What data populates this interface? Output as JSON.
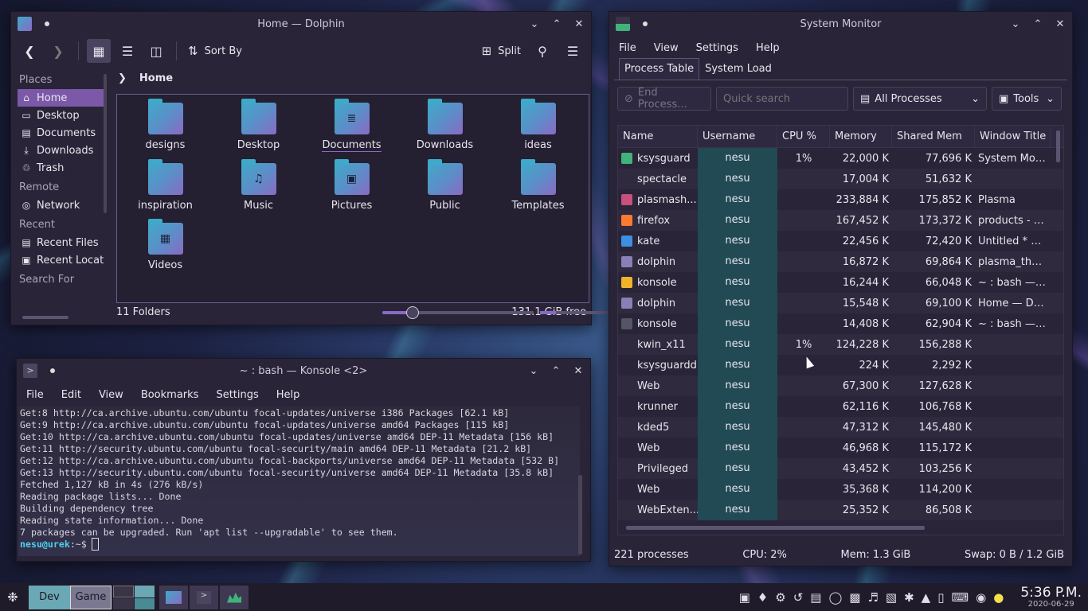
{
  "dolphin": {
    "title": "Home — Dolphin",
    "toolbar": {
      "sort_label": "Sort By",
      "split_label": "Split"
    },
    "places": {
      "sections": [
        {
          "header": "Places",
          "items": [
            "Home",
            "Desktop",
            "Documents",
            "Downloads",
            "Trash"
          ]
        },
        {
          "header": "Remote",
          "items": [
            "Network"
          ]
        },
        {
          "header": "Recent",
          "items": [
            "Recent Files",
            "Recent Locat"
          ]
        },
        {
          "header": "Search For",
          "items": []
        }
      ]
    },
    "breadcrumb": "Home",
    "folders": [
      "designs",
      "Desktop",
      "Documents",
      "Downloads",
      "ideas",
      "inspiration",
      "Music",
      "Pictures",
      "Public",
      "Templates",
      "Videos"
    ],
    "status": {
      "count": "11 Folders",
      "free": "131.1 GiB free"
    },
    "zoom_fraction": 0.2,
    "disk_used_fraction": 0.2
  },
  "konsole": {
    "title": "~ : bash — Konsole <2>",
    "menu": [
      "File",
      "Edit",
      "View",
      "Bookmarks",
      "Settings",
      "Help"
    ],
    "lines": [
      "Get:8 http://ca.archive.ubuntu.com/ubuntu focal-updates/universe i386 Packages [62.1 kB]",
      "Get:9 http://ca.archive.ubuntu.com/ubuntu focal-updates/universe amd64 Packages [115 kB]",
      "Get:10 http://ca.archive.ubuntu.com/ubuntu focal-updates/universe amd64 DEP-11 Metadata [156 kB]",
      "Get:11 http://security.ubuntu.com/ubuntu focal-security/main amd64 DEP-11 Metadata [21.2 kB]",
      "Get:12 http://ca.archive.ubuntu.com/ubuntu focal-backports/universe amd64 DEP-11 Metadata [532 B]",
      "Get:13 http://security.ubuntu.com/ubuntu focal-security/universe amd64 DEP-11 Metadata [35.8 kB]",
      "Fetched 1,127 kB in 4s (276 kB/s)",
      "Reading package lists... Done",
      "Building dependency tree",
      "Reading state information... Done",
      "7 packages can be upgraded. Run 'apt list --upgradable' to see them."
    ],
    "prompt": "nesu@urek",
    "prompt_suffix": ":~$ "
  },
  "sysmon": {
    "title": "System Monitor",
    "menu": [
      "File",
      "View",
      "Settings",
      "Help"
    ],
    "tabs": [
      "Process Table",
      "System Load"
    ],
    "end_process": "End Process...",
    "search_placeholder": "Quick search",
    "filter": "All Processes",
    "tools": "Tools",
    "columns": [
      "Name",
      "Username",
      "CPU %",
      "Memory",
      "Shared Mem",
      "Window Title"
    ],
    "rows": [
      {
        "name": "ksysguard",
        "user": "nesu",
        "cpu": "1%",
        "mem": "22,000 K",
        "shared": "77,696 K",
        "win": "System Monit..",
        "icon": "#3fb37a"
      },
      {
        "name": "spectacle",
        "user": "nesu",
        "cpu": "",
        "mem": "17,004 K",
        "shared": "51,632 K",
        "win": "",
        "icon": ""
      },
      {
        "name": "plasmash...",
        "user": "nesu",
        "cpu": "",
        "mem": "233,884 K",
        "shared": "175,852 K",
        "win": "Plasma",
        "icon": "#c94f7c"
      },
      {
        "name": "firefox",
        "user": "nesu",
        "cpu": "",
        "mem": "167,452 K",
        "shared": "173,372 K",
        "win": "products - pli...",
        "icon": "#ff7a2f"
      },
      {
        "name": "kate",
        "user": "nesu",
        "cpu": "",
        "mem": "22,456 K",
        "shared": "72,420 K",
        "win": "Untitled * — ...",
        "icon": "#3d8fe0"
      },
      {
        "name": "dolphin",
        "user": "nesu",
        "cpu": "",
        "mem": "16,872 K",
        "shared": "69,864 K",
        "win": "plasma_them...",
        "icon": "#8a80b8"
      },
      {
        "name": "konsole",
        "user": "nesu",
        "cpu": "",
        "mem": "16,244 K",
        "shared": "66,048 K",
        "win": "~ : bash — Ko...",
        "icon": "#f0b429"
      },
      {
        "name": "dolphin",
        "user": "nesu",
        "cpu": "",
        "mem": "15,548 K",
        "shared": "69,100 K",
        "win": "Home — Dol...",
        "icon": "#8a80b8"
      },
      {
        "name": "konsole",
        "user": "nesu",
        "cpu": "",
        "mem": "14,408 K",
        "shared": "62,904 K",
        "win": "~ : bash — Ko...",
        "icon": "#555566"
      },
      {
        "name": "kwin_x11",
        "user": "nesu",
        "cpu": "1%",
        "mem": "124,228 K",
        "shared": "156,288 K",
        "win": "",
        "icon": ""
      },
      {
        "name": "ksysguardd",
        "user": "nesu",
        "cpu": "",
        "mem": "224 K",
        "shared": "2,292 K",
        "win": "",
        "icon": ""
      },
      {
        "name": "Web",
        "user": "nesu",
        "cpu": "",
        "mem": "67,300 K",
        "shared": "127,628 K",
        "win": "",
        "icon": ""
      },
      {
        "name": "krunner",
        "user": "nesu",
        "cpu": "",
        "mem": "62,116 K",
        "shared": "106,768 K",
        "win": "",
        "icon": ""
      },
      {
        "name": "kded5",
        "user": "nesu",
        "cpu": "",
        "mem": "47,312 K",
        "shared": "145,480 K",
        "win": "",
        "icon": ""
      },
      {
        "name": "Web",
        "user": "nesu",
        "cpu": "",
        "mem": "46,968 K",
        "shared": "115,172 K",
        "win": "",
        "icon": ""
      },
      {
        "name": "Privileged",
        "user": "nesu",
        "cpu": "",
        "mem": "43,452 K",
        "shared": "103,256 K",
        "win": "",
        "icon": ""
      },
      {
        "name": "Web",
        "user": "nesu",
        "cpu": "",
        "mem": "35,368 K",
        "shared": "114,200 K",
        "win": "",
        "icon": ""
      },
      {
        "name": "WebExten...",
        "user": "nesu",
        "cpu": "",
        "mem": "25,352 K",
        "shared": "86,508 K",
        "win": "",
        "icon": ""
      }
    ],
    "status": {
      "processes": "221 processes",
      "cpu": "CPU: 2%",
      "mem": "Mem: 1.3 GiB",
      "swap": "Swap: 0 B / 1.2 GiB"
    }
  },
  "taskbar": {
    "activities": [
      "Dev",
      "Game"
    ],
    "clock_time": "5:36 P.M.",
    "clock_date": "2020-06-29"
  }
}
